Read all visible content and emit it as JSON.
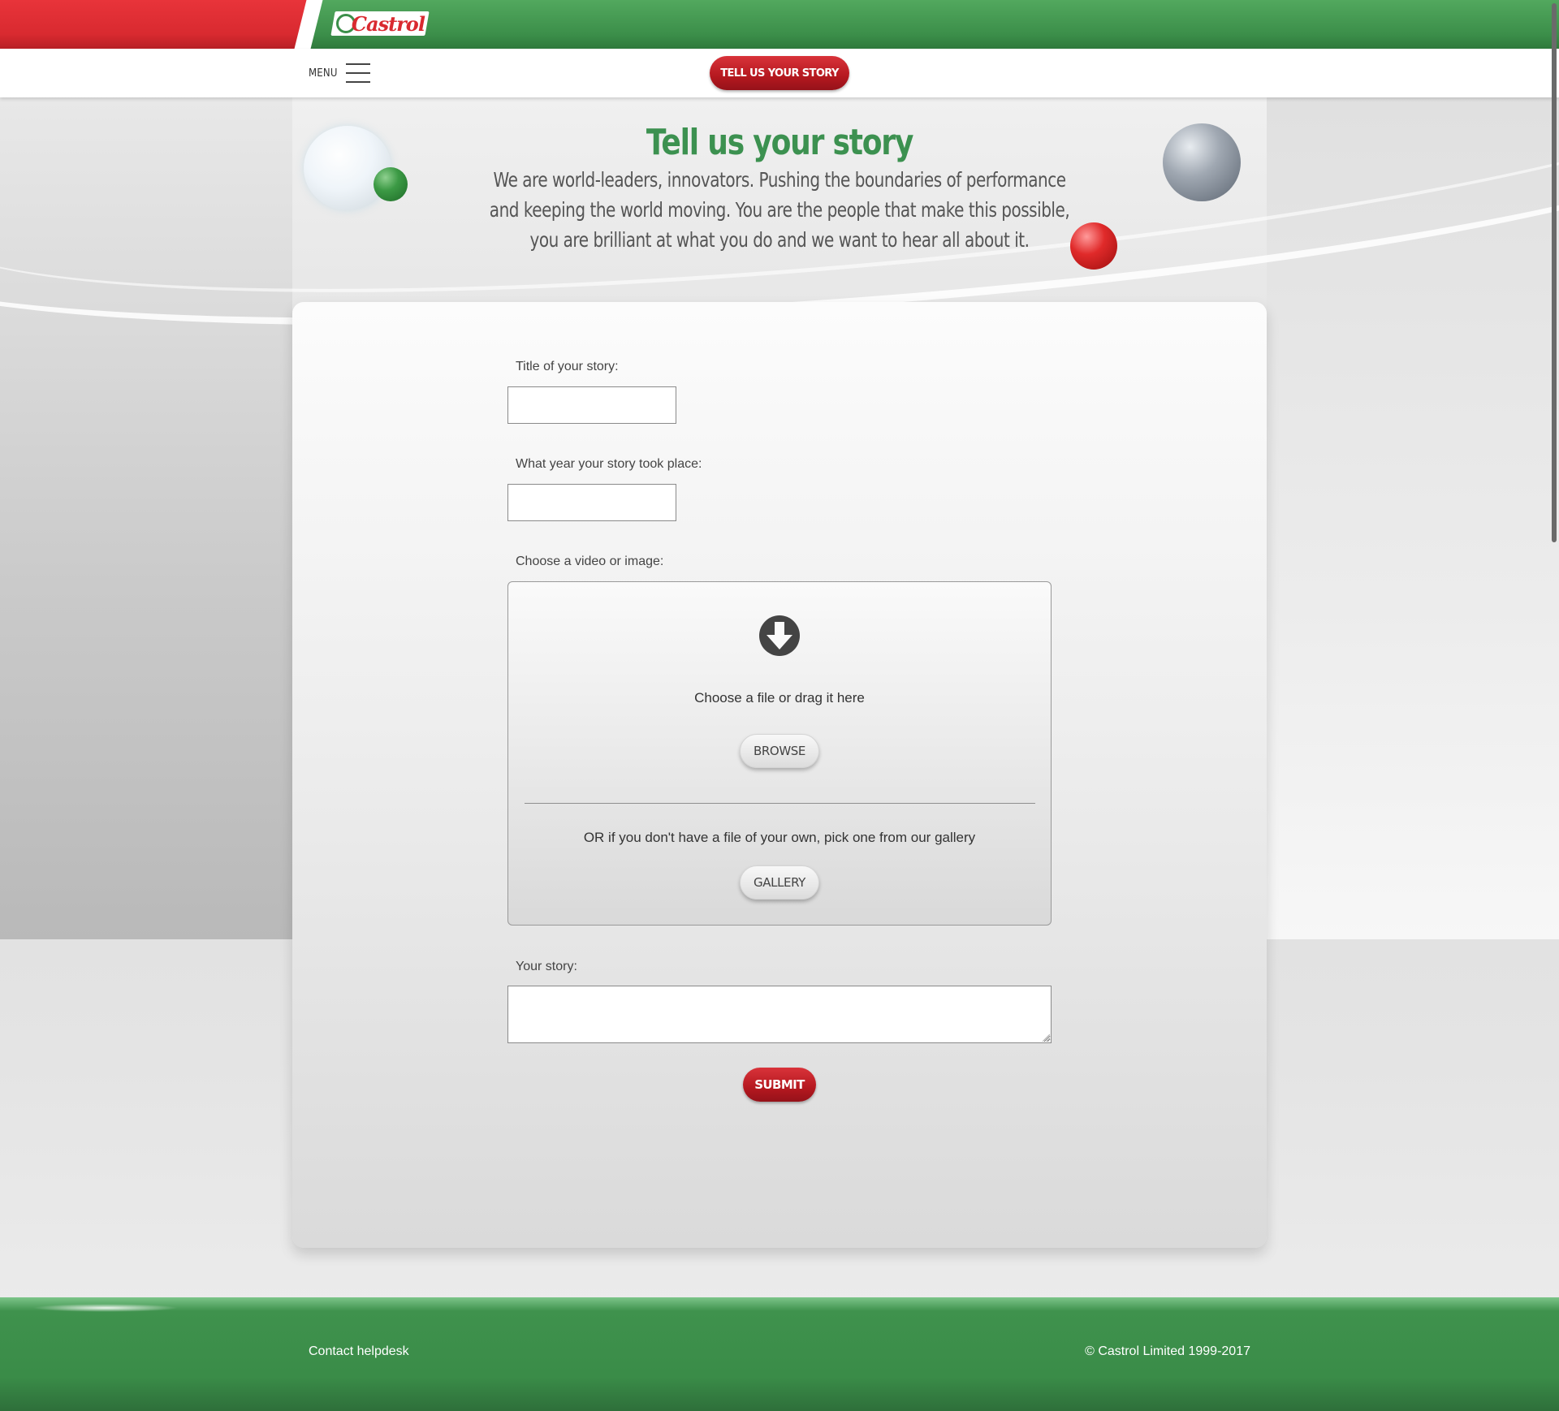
{
  "header": {
    "logo_text": "Castrol"
  },
  "nav": {
    "menu_label": "MENU",
    "cta_label": "TELL US YOUR STORY"
  },
  "hero": {
    "title": "Tell us your story",
    "text": "We are world-leaders, innovators. Pushing the boundaries of performance and keeping the world moving. You are the people that make this possible, you are brilliant at what you do and we want to hear all about it."
  },
  "form": {
    "title_label": "Title of your story:",
    "title_value": "",
    "year_label": "What year your story took place:",
    "year_value": "",
    "media_label": "Choose a video or image:",
    "dropzone_text": "Choose a file or drag it here",
    "browse_label": "BROWSE",
    "gallery_text": "OR if you don't have a file of your own, pick one from our gallery",
    "gallery_label": "GALLERY",
    "story_label": "Your story:",
    "story_value": "",
    "submit_label": "SUBMIT"
  },
  "footer": {
    "contact_label": "Contact helpdesk",
    "copyright": "© Castrol Limited 1999-2017"
  },
  "colors": {
    "brand_green": "#3c9150",
    "brand_red": "#d92a30",
    "button_red": "#b5181f"
  },
  "icons": {
    "upload": "download-arrow-icon",
    "menu": "hamburger-icon"
  }
}
